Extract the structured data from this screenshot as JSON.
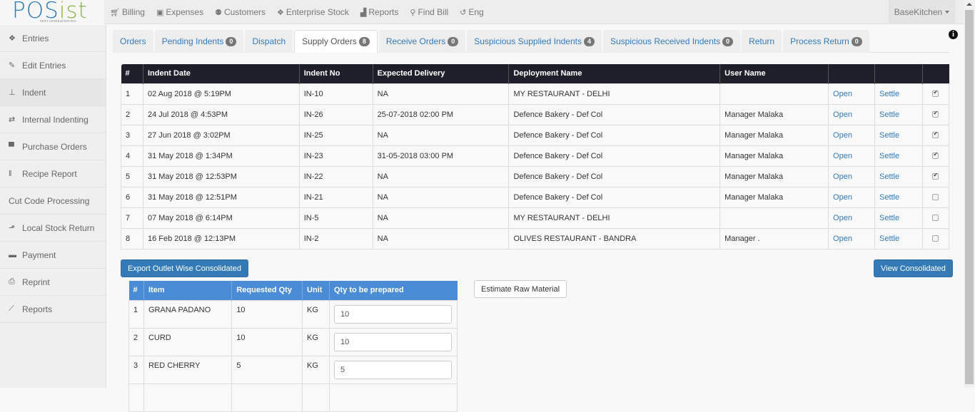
{
  "app": {
    "logo_main": "POS",
    "logo_accent": "ist",
    "logo_tagline": "NEXT GENERATION POS"
  },
  "topnav": {
    "items": [
      {
        "label": "Billing",
        "icon": "cart-icon"
      },
      {
        "label": "Expenses",
        "icon": "money-icon"
      },
      {
        "label": "Customers",
        "icon": "users-icon"
      },
      {
        "label": "Enterprise Stock",
        "icon": "cubes-icon"
      },
      {
        "label": "Reports",
        "icon": "area-chart-icon"
      },
      {
        "label": "Find Bill",
        "icon": "search-icon"
      },
      {
        "label": "Eng",
        "icon": "language-icon"
      }
    ],
    "user_menu": "BaseKitchen"
  },
  "sidebar": {
    "items": [
      {
        "label": "Entries",
        "icon": "cubes-icon"
      },
      {
        "label": "Edit Entries",
        "icon": "edit-icon"
      },
      {
        "label": "Indent",
        "icon": "sitemap-icon",
        "active": true
      },
      {
        "label": "Internal Indenting",
        "icon": "retweet-icon"
      },
      {
        "label": "Purchase Orders",
        "icon": "cart-icon"
      },
      {
        "label": "Recipe Report",
        "icon": "cutlery-icon"
      },
      {
        "label": "Cut Code Processing",
        "icon": ""
      },
      {
        "label": "Local Stock Return",
        "icon": "share-icon"
      },
      {
        "label": "Payment",
        "icon": "credit-card-icon"
      },
      {
        "label": "Reprint",
        "icon": "print-icon"
      },
      {
        "label": "Reports",
        "icon": "line-chart-icon"
      }
    ]
  },
  "tabs": [
    {
      "label": "Orders",
      "badge": null
    },
    {
      "label": "Pending Indents",
      "badge": "0"
    },
    {
      "label": "Dispatch",
      "badge": null
    },
    {
      "label": "Supply Orders",
      "badge": "8",
      "active": true
    },
    {
      "label": "Receive Orders",
      "badge": "0"
    },
    {
      "label": "Suspicious Supplied Indents",
      "badge": "4"
    },
    {
      "label": "Suspicious Received Indents",
      "badge": "0"
    },
    {
      "label": "Return",
      "badge": null
    },
    {
      "label": "Process Return",
      "badge": "0"
    }
  ],
  "orders_table": {
    "headers": [
      "#",
      "Indent Date",
      "Indent No",
      "Expected Delivery",
      "Deployment Name",
      "User Name",
      "",
      "",
      ""
    ],
    "open_label": "Open",
    "settle_label": "Settle",
    "rows": [
      {
        "num": "1",
        "date": "02 Aug 2018 @ 5:19PM",
        "indent_no": "IN-10",
        "expected": "NA",
        "deployment": "MY RESTAURANT - DELHI",
        "user": "",
        "checked": true
      },
      {
        "num": "2",
        "date": "24 Jul 2018 @ 4:53PM",
        "indent_no": "IN-26",
        "expected": "25-07-2018 02:00 PM",
        "deployment": "Defence Bakery - Def Col",
        "user": "Manager Malaka",
        "checked": true
      },
      {
        "num": "3",
        "date": "27 Jun 2018 @ 3:02PM",
        "indent_no": "IN-25",
        "expected": "NA",
        "deployment": "Defence Bakery - Def Col",
        "user": "Manager Malaka",
        "checked": true
      },
      {
        "num": "4",
        "date": "31 May 2018 @ 1:34PM",
        "indent_no": "IN-23",
        "expected": "31-05-2018 03:00 PM",
        "deployment": "Defence Bakery - Def Col",
        "user": "Manager Malaka",
        "checked": true
      },
      {
        "num": "5",
        "date": "31 May 2018 @ 12:53PM",
        "indent_no": "IN-22",
        "expected": "NA",
        "deployment": "Defence Bakery - Def Col",
        "user": "Manager Malaka",
        "checked": true
      },
      {
        "num": "6",
        "date": "31 May 2018 @ 12:51PM",
        "indent_no": "IN-21",
        "expected": "NA",
        "deployment": "Defence Bakery - Def Col",
        "user": "Manager Malaka",
        "checked": false
      },
      {
        "num": "7",
        "date": "07 May 2018 @ 6:14PM",
        "indent_no": "IN-5",
        "expected": "NA",
        "deployment": "MY RESTAURANT - DELHI",
        "user": "",
        "checked": false
      },
      {
        "num": "8",
        "date": "16 Feb 2018 @ 12:13PM",
        "indent_no": "IN-2",
        "expected": "NA",
        "deployment": "OLIVES RESTAURANT - BANDRA",
        "user": "Manager .",
        "checked": false
      }
    ]
  },
  "buttons": {
    "export": "Export Outlet Wise Consolidated",
    "view_consolidated": "View Consolidated",
    "estimate": "Estimate Raw Material"
  },
  "items_table": {
    "headers": [
      "#",
      "Item",
      "Requested Qty",
      "Unit",
      "Qty to be prepared"
    ],
    "rows": [
      {
        "num": "1",
        "item": "GRANA PADANO",
        "requested": "10",
        "unit": "KG",
        "prepare": "10"
      },
      {
        "num": "2",
        "item": "CURD",
        "requested": "10",
        "unit": "KG",
        "prepare": "10"
      },
      {
        "num": "3",
        "item": "RED CHERRY",
        "requested": "5",
        "unit": "KG",
        "prepare": "5"
      }
    ]
  },
  "colors": {
    "brand_blue": "#2a7ab5",
    "brand_green": "#8cb43c",
    "table_header_dark": "#1f1f2b",
    "table_header_blue": "#4a8cd6",
    "link": "#337ab7"
  }
}
